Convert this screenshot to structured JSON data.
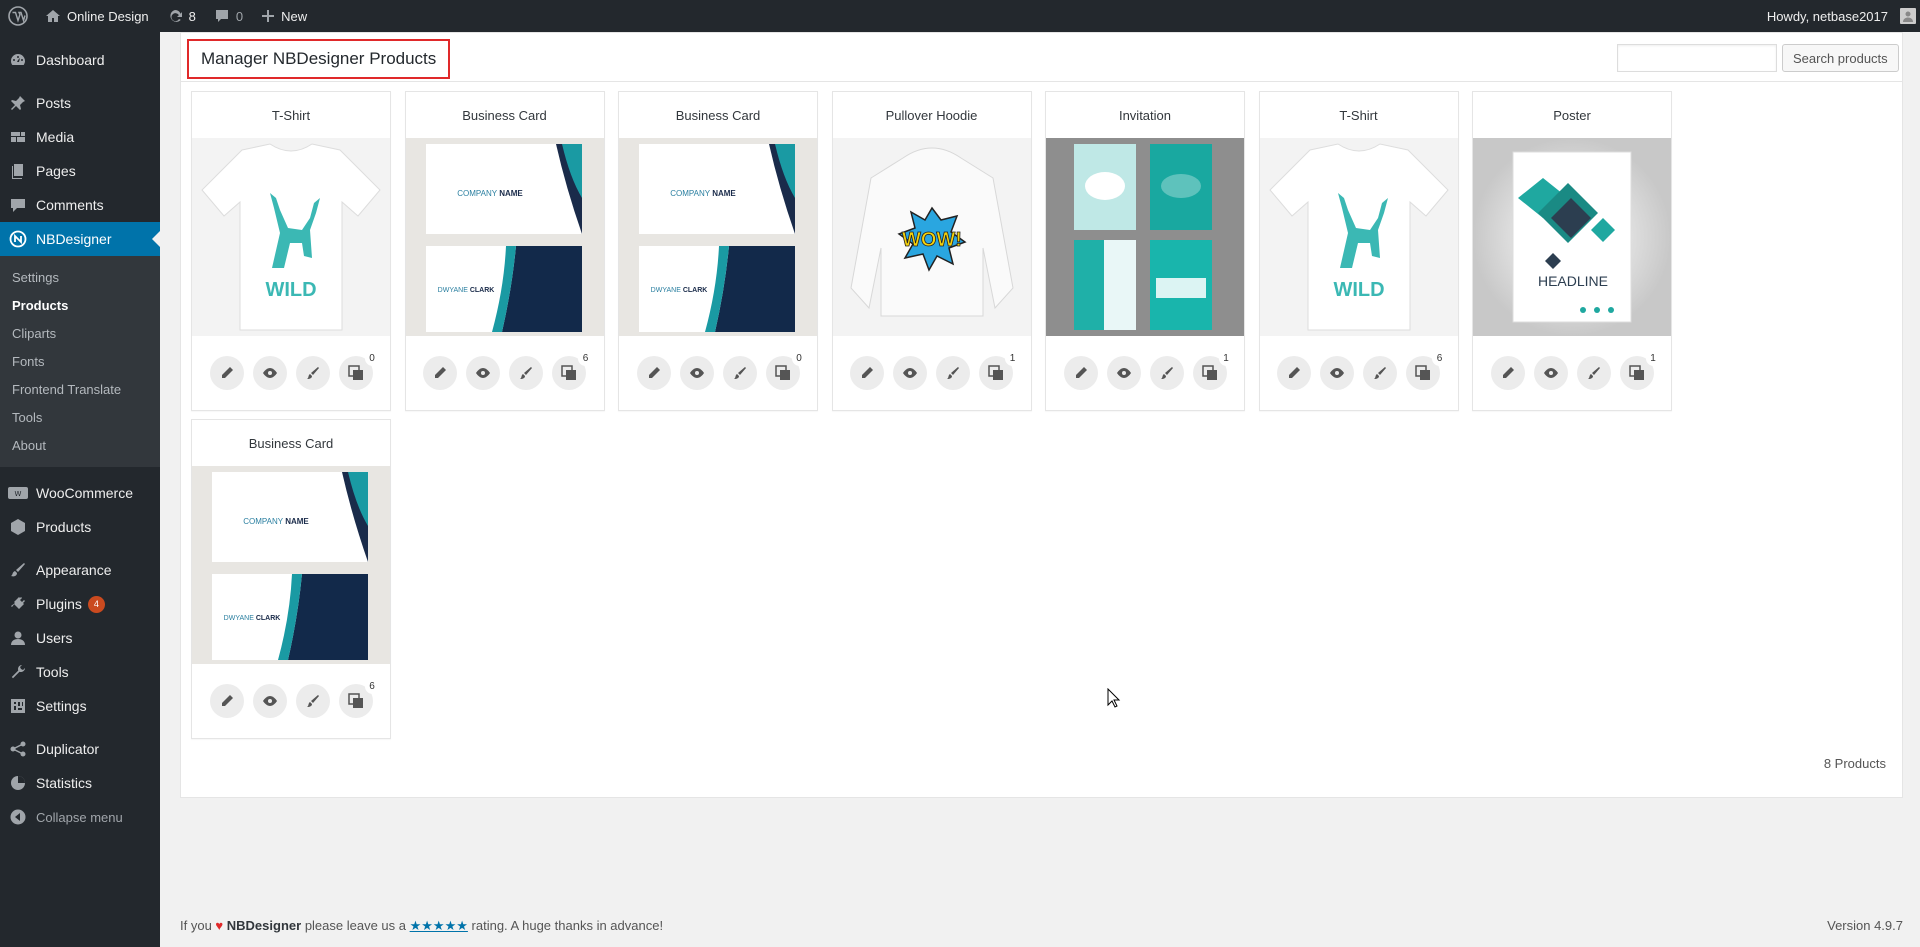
{
  "adminbar": {
    "site_name": "Online Design",
    "updates_count": "8",
    "comments_count": "0",
    "new_label": "New",
    "howdy": "Howdy, netbase2017"
  },
  "sidebar": {
    "items": [
      {
        "label": "Dashboard",
        "icon": "dashboard-icon"
      },
      {
        "label": "Posts",
        "icon": "pin-icon"
      },
      {
        "label": "Media",
        "icon": "media-icon"
      },
      {
        "label": "Pages",
        "icon": "pages-icon"
      },
      {
        "label": "Comments",
        "icon": "comment-icon"
      },
      {
        "label": "NBDesigner",
        "icon": "nbdesigner-icon"
      }
    ],
    "submenu": [
      "Settings",
      "Products",
      "Cliparts",
      "Fonts",
      "Frontend Translate",
      "Tools",
      "About"
    ],
    "items2": [
      {
        "label": "WooCommerce",
        "icon": "woo-icon"
      },
      {
        "label": "Products",
        "icon": "box-icon"
      }
    ],
    "items3": [
      {
        "label": "Appearance",
        "icon": "brush-icon"
      },
      {
        "label": "Plugins",
        "icon": "plugin-icon",
        "badge": "4"
      },
      {
        "label": "Users",
        "icon": "user-icon"
      },
      {
        "label": "Tools",
        "icon": "wrench-icon"
      },
      {
        "label": "Settings",
        "icon": "settings-icon"
      }
    ],
    "items4": [
      {
        "label": "Duplicator",
        "icon": "share-icon"
      },
      {
        "label": "Statistics",
        "icon": "chart-icon"
      }
    ],
    "collapse": "Collapse menu"
  },
  "main": {
    "title": "Manager NBDesigner Products",
    "search_button": "Search products",
    "search_value": "",
    "products": [
      {
        "name": "T-Shirt",
        "count": "0",
        "image": "tshirt"
      },
      {
        "name": "Business Card",
        "count": "6",
        "image": "card"
      },
      {
        "name": "Business Card",
        "count": "0",
        "image": "card"
      },
      {
        "name": "Pullover Hoodie",
        "count": "1",
        "image": "hoodie"
      },
      {
        "name": "Invitation",
        "count": "1",
        "image": "invitation"
      },
      {
        "name": "T-Shirt",
        "count": "6",
        "image": "tshirt"
      },
      {
        "name": "Poster",
        "count": "1",
        "image": "poster"
      },
      {
        "name": "Business Card",
        "count": "6",
        "image": "card"
      }
    ],
    "total_label": "8 Products",
    "artwork": {
      "tshirt_text": "WILD",
      "card_company": "COMPANY",
      "card_name": "NAME",
      "card_person_first": "DWYANE",
      "card_person_last": "CLARK",
      "hoodie_text": "WOW!",
      "poster_text": "HEADLINE"
    }
  },
  "footer": {
    "pre": "If you",
    "brand": "NBDesigner",
    "mid": "please leave us a",
    "stars": "★★★★★",
    "post": "rating. A huge thanks in advance!",
    "version": "Version 4.9.7"
  },
  "colors": {
    "accent": "#0073aa",
    "sidebar": "#23282d",
    "highlight": "#e0292a",
    "teal": "#3bb8b4"
  }
}
